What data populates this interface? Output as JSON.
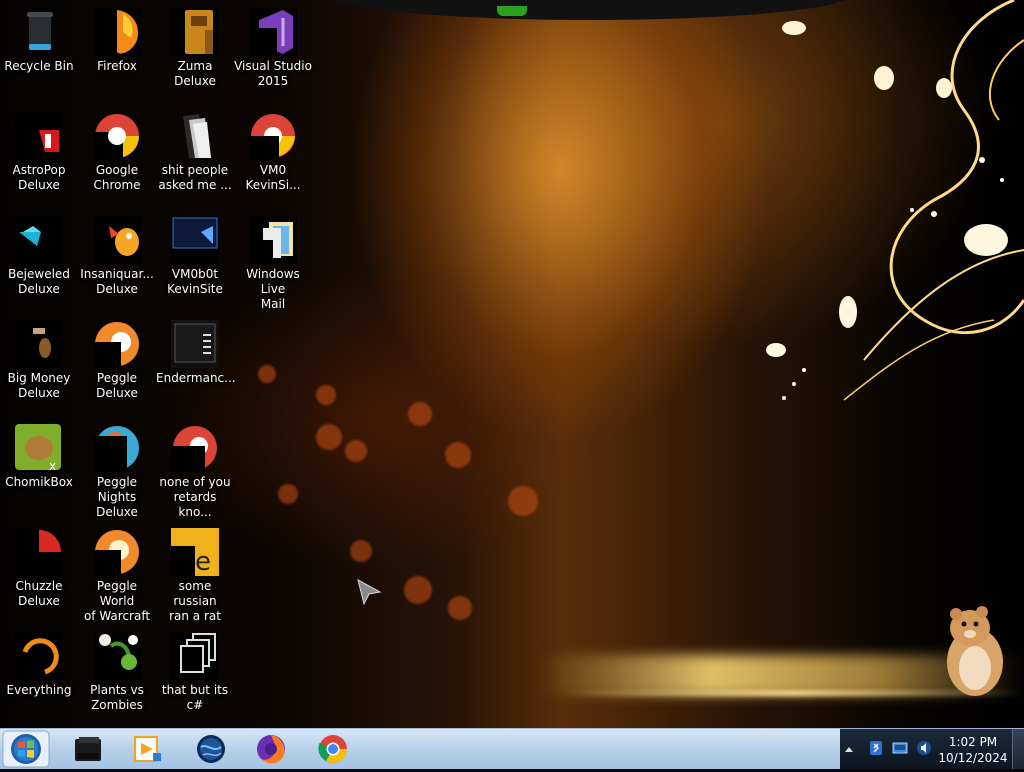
{
  "desktop": {
    "icons": [
      {
        "label": "Recycle Bin"
      },
      {
        "label": "Firefox"
      },
      {
        "label": "Zuma Deluxe"
      },
      {
        "label": "Visual Studio\n2015"
      },
      {
        "label": "AstroPop\nDeluxe"
      },
      {
        "label": "Google\nChrome"
      },
      {
        "label": "shit people\nasked me ..."
      },
      {
        "label": "VM0\nKevinSi..."
      },
      {
        "label": "Bejeweled\nDeluxe"
      },
      {
        "label": "Insaniquar...\nDeluxe"
      },
      {
        "label": "VM0b0t\nKevinSite"
      },
      {
        "label": "Windows Live\nMail"
      },
      {
        "label": "Big Money\nDeluxe"
      },
      {
        "label": "Peggle Deluxe"
      },
      {
        "label": "Endermanc..."
      },
      {
        "label": "ChomikBox"
      },
      {
        "label": "Peggle Nights\nDeluxe"
      },
      {
        "label": "none of you\nretards kno..."
      },
      {
        "label": "Chuzzle\nDeluxe"
      },
      {
        "label": "Peggle World\nof Warcraft ..."
      },
      {
        "label": "some russian\nran a rat"
      },
      {
        "label": "Everything"
      },
      {
        "label": "Plants vs\nZombies"
      },
      {
        "label": "that but its c#"
      }
    ]
  },
  "taskbar": {
    "pinned": [
      "terminal-icon",
      "media-player-icon",
      "globe-icon",
      "firefox-icon",
      "chrome-icon"
    ],
    "clock": {
      "time": "1:02 PM",
      "date": "10/12/2024"
    }
  },
  "colors": {
    "taskbar": "#b7d0ea",
    "tray": "#1c2a3a",
    "accent": "#f0a020"
  }
}
